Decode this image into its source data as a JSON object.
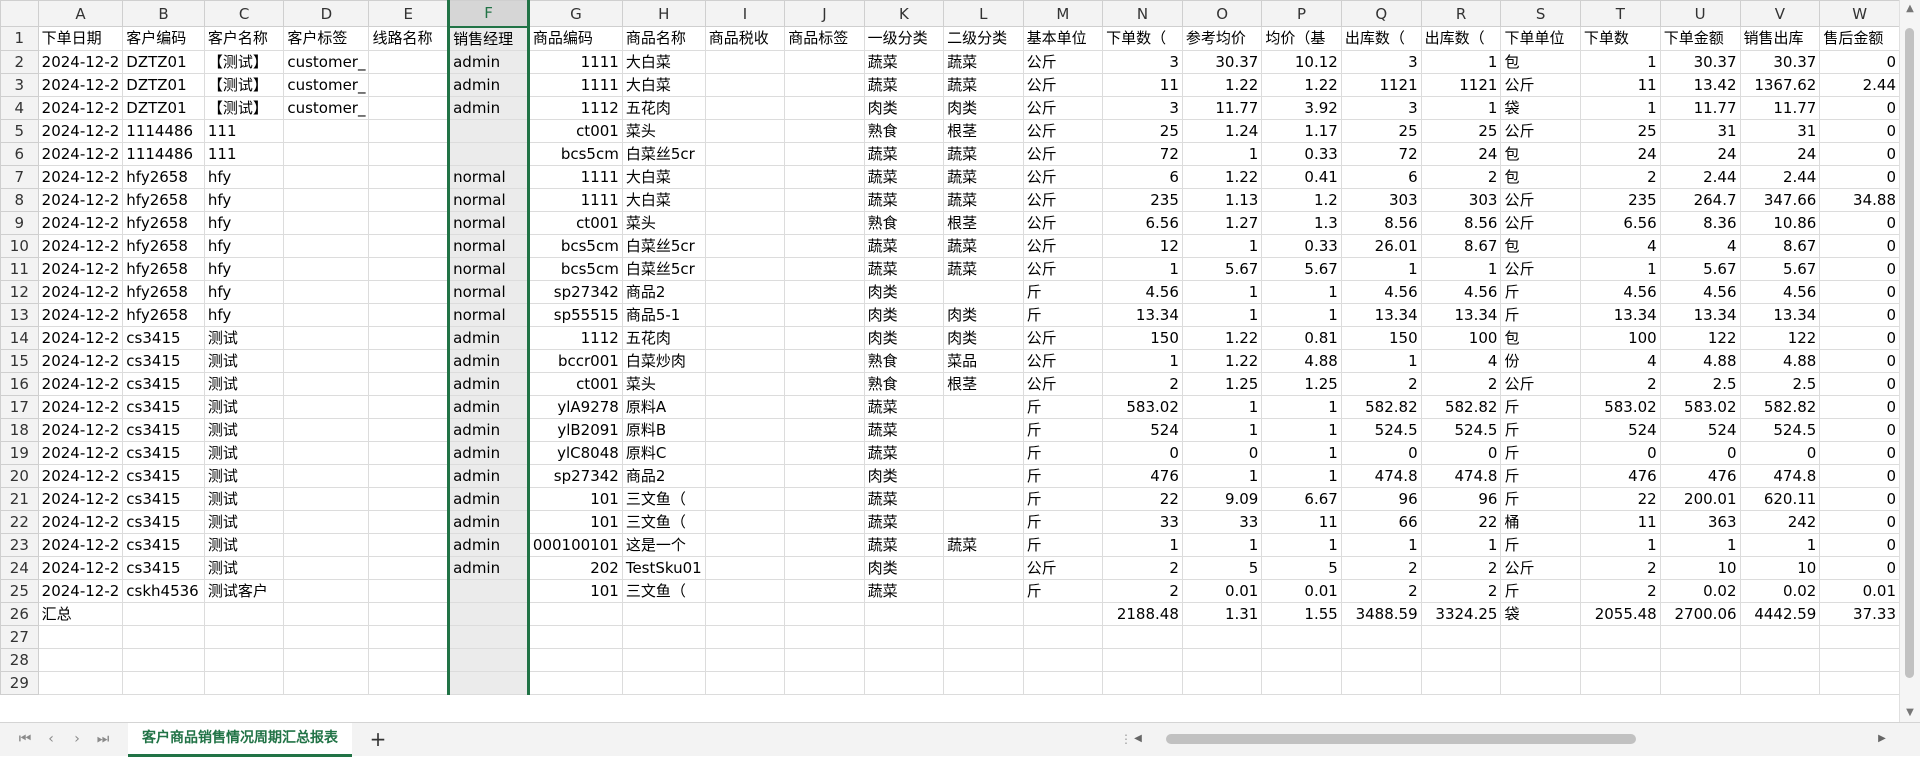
{
  "sheet": {
    "columns": [
      "A",
      "B",
      "C",
      "D",
      "E",
      "F",
      "G",
      "H",
      "I",
      "J",
      "K",
      "L",
      "M",
      "N",
      "O",
      "P",
      "Q",
      "R",
      "S",
      "T",
      "U",
      "V",
      "W"
    ],
    "selected_column": "F",
    "header_row": [
      "下单日期",
      "客户编码",
      "客户名称",
      "客户标签",
      "线路名称",
      "销售经理",
      "商品编码",
      "商品名称",
      "商品税收",
      "商品标签",
      "一级分类",
      "二级分类",
      "基本单位",
      "下单数（",
      "参考均价",
      "均价（基",
      "出库数（",
      "出库数（",
      "下单单位",
      "下单数",
      "下单金额",
      "销售出库",
      "售后金额"
    ],
    "rows": [
      [
        "2024-12-2",
        "DZTZ01",
        "【测试】",
        "customer_",
        "",
        "admin",
        "1111",
        "大白菜",
        "",
        "",
        "蔬菜",
        "蔬菜",
        "公斤",
        "3",
        "30.37",
        "10.12",
        "3",
        "1",
        "包",
        "1",
        "30.37",
        "30.37",
        "0"
      ],
      [
        "2024-12-2",
        "DZTZ01",
        "【测试】",
        "customer_",
        "",
        "admin",
        "1111",
        "大白菜",
        "",
        "",
        "蔬菜",
        "蔬菜",
        "公斤",
        "11",
        "1.22",
        "1.22",
        "1121",
        "1121",
        "公斤",
        "11",
        "13.42",
        "1367.62",
        "2.44"
      ],
      [
        "2024-12-2",
        "DZTZ01",
        "【测试】",
        "customer_",
        "",
        "admin",
        "1112",
        "五花肉",
        "",
        "",
        "肉类",
        "肉类",
        "公斤",
        "3",
        "11.77",
        "3.92",
        "3",
        "1",
        "袋",
        "1",
        "11.77",
        "11.77",
        "0"
      ],
      [
        "2024-12-2",
        "1114486",
        "111",
        "",
        "",
        "",
        "ct001",
        "菜头",
        "",
        "",
        "熟食",
        "根茎",
        "公斤",
        "25",
        "1.24",
        "1.17",
        "25",
        "25",
        "公斤",
        "25",
        "31",
        "31",
        "0"
      ],
      [
        "2024-12-2",
        "1114486",
        "111",
        "",
        "",
        "",
        "bcs5cm",
        "白菜丝5cr",
        "",
        "",
        "蔬菜",
        "蔬菜",
        "公斤",
        "72",
        "1",
        "0.33",
        "72",
        "24",
        "包",
        "24",
        "24",
        "24",
        "0"
      ],
      [
        "2024-12-2",
        "hfy2658",
        "hfy",
        "",
        "",
        "normal",
        "1111",
        "大白菜",
        "",
        "",
        "蔬菜",
        "蔬菜",
        "公斤",
        "6",
        "1.22",
        "0.41",
        "6",
        "2",
        "包",
        "2",
        "2.44",
        "2.44",
        "0"
      ],
      [
        "2024-12-2",
        "hfy2658",
        "hfy",
        "",
        "",
        "normal",
        "1111",
        "大白菜",
        "",
        "",
        "蔬菜",
        "蔬菜",
        "公斤",
        "235",
        "1.13",
        "1.2",
        "303",
        "303",
        "公斤",
        "235",
        "264.7",
        "347.66",
        "34.88"
      ],
      [
        "2024-12-2",
        "hfy2658",
        "hfy",
        "",
        "",
        "normal",
        "ct001",
        "菜头",
        "",
        "",
        "熟食",
        "根茎",
        "公斤",
        "6.56",
        "1.27",
        "1.3",
        "8.56",
        "8.56",
        "公斤",
        "6.56",
        "8.36",
        "10.86",
        "0"
      ],
      [
        "2024-12-2",
        "hfy2658",
        "hfy",
        "",
        "",
        "normal",
        "bcs5cm",
        "白菜丝5cr",
        "",
        "",
        "蔬菜",
        "蔬菜",
        "公斤",
        "12",
        "1",
        "0.33",
        "26.01",
        "8.67",
        "包",
        "4",
        "4",
        "8.67",
        "0"
      ],
      [
        "2024-12-2",
        "hfy2658",
        "hfy",
        "",
        "",
        "normal",
        "bcs5cm",
        "白菜丝5cr",
        "",
        "",
        "蔬菜",
        "蔬菜",
        "公斤",
        "1",
        "5.67",
        "5.67",
        "1",
        "1",
        "公斤",
        "1",
        "5.67",
        "5.67",
        "0"
      ],
      [
        "2024-12-2",
        "hfy2658",
        "hfy",
        "",
        "",
        "normal",
        "sp27342",
        "商品2",
        "",
        "",
        "肉类",
        "",
        "斤",
        "4.56",
        "1",
        "1",
        "4.56",
        "4.56",
        "斤",
        "4.56",
        "4.56",
        "4.56",
        "0"
      ],
      [
        "2024-12-2",
        "hfy2658",
        "hfy",
        "",
        "",
        "normal",
        "sp55515",
        "商品5-1",
        "",
        "",
        "肉类",
        "肉类",
        "斤",
        "13.34",
        "1",
        "1",
        "13.34",
        "13.34",
        "斤",
        "13.34",
        "13.34",
        "13.34",
        "0"
      ],
      [
        "2024-12-2",
        "cs3415",
        "测试",
        "",
        "",
        "admin",
        "1112",
        "五花肉",
        "",
        "",
        "肉类",
        "肉类",
        "公斤",
        "150",
        "1.22",
        "0.81",
        "150",
        "100",
        "包",
        "100",
        "122",
        "122",
        "0"
      ],
      [
        "2024-12-2",
        "cs3415",
        "测试",
        "",
        "",
        "admin",
        "bccr001",
        "白菜炒肉",
        "",
        "",
        "熟食",
        "菜品",
        "公斤",
        "1",
        "1.22",
        "4.88",
        "1",
        "4",
        "份",
        "4",
        "4.88",
        "4.88",
        "0"
      ],
      [
        "2024-12-2",
        "cs3415",
        "测试",
        "",
        "",
        "admin",
        "ct001",
        "菜头",
        "",
        "",
        "熟食",
        "根茎",
        "公斤",
        "2",
        "1.25",
        "1.25",
        "2",
        "2",
        "公斤",
        "2",
        "2.5",
        "2.5",
        "0"
      ],
      [
        "2024-12-2",
        "cs3415",
        "测试",
        "",
        "",
        "admin",
        "ylA9278",
        "原料A",
        "",
        "",
        "蔬菜",
        "",
        "斤",
        "583.02",
        "1",
        "1",
        "582.82",
        "582.82",
        "斤",
        "583.02",
        "583.02",
        "582.82",
        "0"
      ],
      [
        "2024-12-2",
        "cs3415",
        "测试",
        "",
        "",
        "admin",
        "ylB2091",
        "原料B",
        "",
        "",
        "蔬菜",
        "",
        "斤",
        "524",
        "1",
        "1",
        "524.5",
        "524.5",
        "斤",
        "524",
        "524",
        "524.5",
        "0"
      ],
      [
        "2024-12-2",
        "cs3415",
        "测试",
        "",
        "",
        "admin",
        "ylC8048",
        "原料C",
        "",
        "",
        "蔬菜",
        "",
        "斤",
        "0",
        "0",
        "1",
        "0",
        "0",
        "斤",
        "0",
        "0",
        "0",
        "0"
      ],
      [
        "2024-12-2",
        "cs3415",
        "测试",
        "",
        "",
        "admin",
        "sp27342",
        "商品2",
        "",
        "",
        "肉类",
        "",
        "斤",
        "476",
        "1",
        "1",
        "474.8",
        "474.8",
        "斤",
        "476",
        "476",
        "474.8",
        "0"
      ],
      [
        "2024-12-2",
        "cs3415",
        "测试",
        "",
        "",
        "admin",
        "101",
        "三文鱼（",
        "",
        "",
        "蔬菜",
        "",
        "斤",
        "22",
        "9.09",
        "6.67",
        "96",
        "96",
        "斤",
        "22",
        "200.01",
        "620.11",
        "0"
      ],
      [
        "2024-12-2",
        "cs3415",
        "测试",
        "",
        "",
        "admin",
        "101",
        "三文鱼（",
        "",
        "",
        "蔬菜",
        "",
        "斤",
        "33",
        "33",
        "11",
        "66",
        "22",
        "桶",
        "11",
        "363",
        "242",
        "0"
      ],
      [
        "2024-12-2",
        "cs3415",
        "测试",
        "",
        "",
        "admin",
        "000100101",
        "这是一个",
        "",
        "",
        "蔬菜",
        "蔬菜",
        "斤",
        "1",
        "1",
        "1",
        "1",
        "1",
        "斤",
        "1",
        "1",
        "1",
        "0"
      ],
      [
        "2024-12-2",
        "cs3415",
        "测试",
        "",
        "",
        "admin",
        "202",
        "TestSku01",
        "",
        "",
        "肉类",
        "",
        "公斤",
        "2",
        "5",
        "5",
        "2",
        "2",
        "公斤",
        "2",
        "10",
        "10",
        "0"
      ],
      [
        "2024-12-2",
        "cskh4536",
        "测试客户",
        "",
        "",
        "",
        "101",
        "三文鱼（",
        "",
        "",
        "蔬菜",
        "",
        "斤",
        "2",
        "0.01",
        "0.01",
        "2",
        "2",
        "斤",
        "2",
        "0.02",
        "0.02",
        "0.01"
      ],
      [
        "汇总",
        "",
        "",
        "",
        "",
        "",
        "",
        "",
        "",
        "",
        "",
        "",
        "",
        "2188.48",
        "1.31",
        "1.55",
        "3488.59",
        "3324.25",
        "袋",
        "2055.48",
        "2700.06",
        "4442.59",
        "37.33"
      ]
    ],
    "row_numbers": [
      "1",
      "2",
      "3",
      "4",
      "5",
      "6",
      "7",
      "8",
      "9",
      "10",
      "11",
      "12",
      "13",
      "14",
      "15",
      "16",
      "17",
      "18",
      "19",
      "20",
      "21",
      "22",
      "23",
      "24",
      "25",
      "26",
      "27",
      "28",
      "29"
    ]
  },
  "tabbar": {
    "nav_first": "⏮",
    "nav_prev": "‹",
    "nav_next": "›",
    "nav_last": "⏭",
    "active_sheet": "客户商品销售情况周期汇总报表",
    "add_sheet": "+"
  },
  "colors": {
    "accent": "#217346",
    "header_bg": "#f3f3f3",
    "selected_col_bg": "#ebebeb",
    "grid_line": "#dcdcdc"
  }
}
